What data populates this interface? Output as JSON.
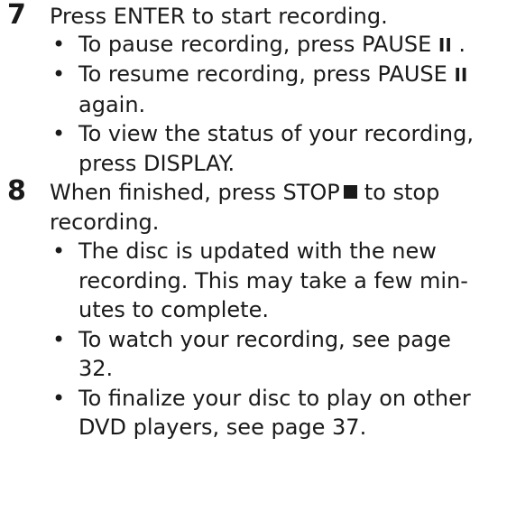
{
  "steps": [
    {
      "number": "7",
      "text": "Press ENTER to start recording.",
      "bullets": [
        {
          "before": "To pause recording, press PAUSE ",
          "glyph": "II",
          "after": " ."
        },
        {
          "before": "To resume recording, press PAUSE ",
          "glyph": "II",
          "after": "",
          "line2": "again."
        },
        {
          "before": "To view the status of your recording,",
          "line2": "press DISPLAY."
        }
      ]
    },
    {
      "number": "8",
      "text_before": "When finished, press STOP",
      "text_after": "to stop",
      "text_line2": "recording.",
      "bullets": [
        {
          "line1": "The disc is updated with the new",
          "line2": "recording. This may take a few min-",
          "line3": "utes to complete."
        },
        {
          "line1": "To watch your recording, see page",
          "line2": "32."
        },
        {
          "line1": "To finalize your disc to play on other",
          "line2": "DVD players, see page 37."
        }
      ]
    }
  ],
  "bullet_glyph": "•",
  "icons": {
    "pause": "pause-icon",
    "stop": "stop-square-icon"
  }
}
